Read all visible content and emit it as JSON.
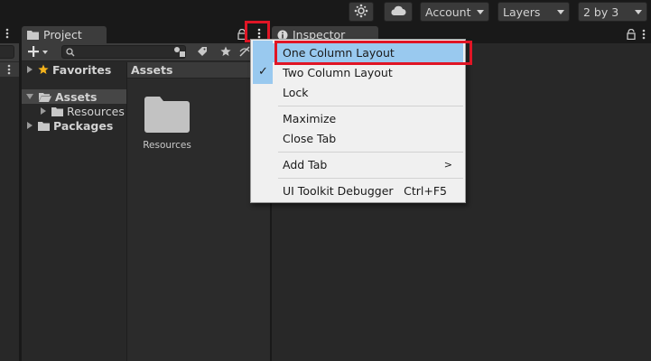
{
  "toolbar": {
    "account_label": "Account",
    "layers_label": "Layers",
    "layout_label": "2 by 3",
    "collab_icon": "collab-icon",
    "cloud_icon": "cloud-icon"
  },
  "project": {
    "tab_label": "Project",
    "favorites_label": "Favorites",
    "assets_label": "Assets",
    "resources_label": "Resources",
    "packages_label": "Packages",
    "assets_header": "Assets",
    "folder_label": "Resources"
  },
  "inspector": {
    "tab_label": "Inspector"
  },
  "context_menu": {
    "items": [
      {
        "label": "One Column Layout",
        "highlighted": true
      },
      {
        "label": "Two Column Layout",
        "checked": true
      },
      {
        "label": "Lock"
      },
      {
        "label": "Maximize"
      },
      {
        "label": "Close Tab"
      },
      {
        "label": "Add Tab",
        "submenu": true
      },
      {
        "label": "UI Toolkit Debugger",
        "shortcut": "Ctrl+F5"
      }
    ],
    "submenu_arrow": ">",
    "check_mark": "✓"
  },
  "colors": {
    "menu_highlight": "#99c9ef",
    "annotation_red": "#e01525",
    "check_band": "#99c9ef"
  }
}
